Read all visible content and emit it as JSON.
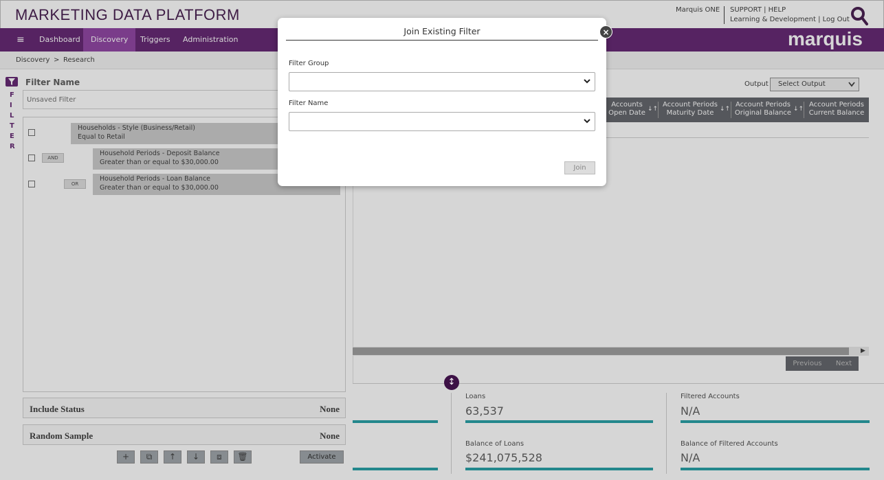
{
  "header": {
    "app_title": "MARKETING DATA PLATFORM",
    "user_name": "Marquis ONE",
    "links_line1": "SUPPORT | HELP",
    "links_line2": "Learning & Development | Log Out",
    "brand": "marquis"
  },
  "nav": {
    "menu_icon": "≡",
    "items": [
      {
        "label": "Dashboard"
      },
      {
        "label": "Discovery",
        "active": true
      },
      {
        "label": "Triggers"
      },
      {
        "label": "Administration"
      }
    ],
    "active_color": "#8a3a9e",
    "bar_color": "#5b1a6b"
  },
  "breadcrumb": {
    "items": [
      "Discovery",
      ">",
      "Research"
    ]
  },
  "filter_panel": {
    "tab_letters": [
      "F",
      "I",
      "L",
      "T",
      "E",
      "R"
    ],
    "filter_name_label": "Filter Name",
    "filter_name_value": "Unsaved Filter",
    "criteria": [
      {
        "line1": "Households - Style (Business/Retail)",
        "line2": "Equal to Retail",
        "operator": ""
      },
      {
        "line1": "Household Periods - Deposit Balance",
        "line2": "Greater than or equal to $30,000.00",
        "operator": "AND"
      },
      {
        "line1": "Household Periods - Loan Balance",
        "line2": "Greater than or equal to $30,000.00",
        "operator": "OR"
      }
    ],
    "include_status": {
      "label": "Include Status",
      "value": "None"
    },
    "random_sample": {
      "label": "Random Sample",
      "value": "None"
    },
    "toolbar": {
      "add": "+",
      "group": "⧉",
      "up": "↑",
      "down": "↓",
      "ungroup": "⧈",
      "delete": "🗑"
    },
    "activate_label": "Activate"
  },
  "results": {
    "output_label": "Output",
    "output_select": "Select Output",
    "columns": [
      {
        "line1": "Accounts",
        "line2": "Open Date"
      },
      {
        "line1": "Account Periods",
        "line2": "Maturity Date"
      },
      {
        "line1": "Account Periods",
        "line2": "Original Balance"
      },
      {
        "line1": "Account Periods",
        "line2": "Current Balance"
      }
    ],
    "sort_icon": "↓↑",
    "previous_label": "Previous",
    "next_label": "Next"
  },
  "stats": {
    "loans": {
      "label": "Loans",
      "value": "63,537"
    },
    "filtered_accounts": {
      "label": "Filtered Accounts",
      "value": "N/A"
    },
    "balance_of_loans": {
      "label": "Balance of Loans",
      "value": "$241,075,528"
    },
    "balance_filtered": {
      "label": "Balance of Filtered Accounts",
      "value": "N/A"
    },
    "bar_color": "#1a9aa0"
  },
  "modal": {
    "title": "Join Existing Filter",
    "filter_group_label": "Filter Group",
    "filter_group_value": "",
    "filter_name_label": "Filter Name",
    "filter_name_value": "",
    "join_label": "Join"
  }
}
